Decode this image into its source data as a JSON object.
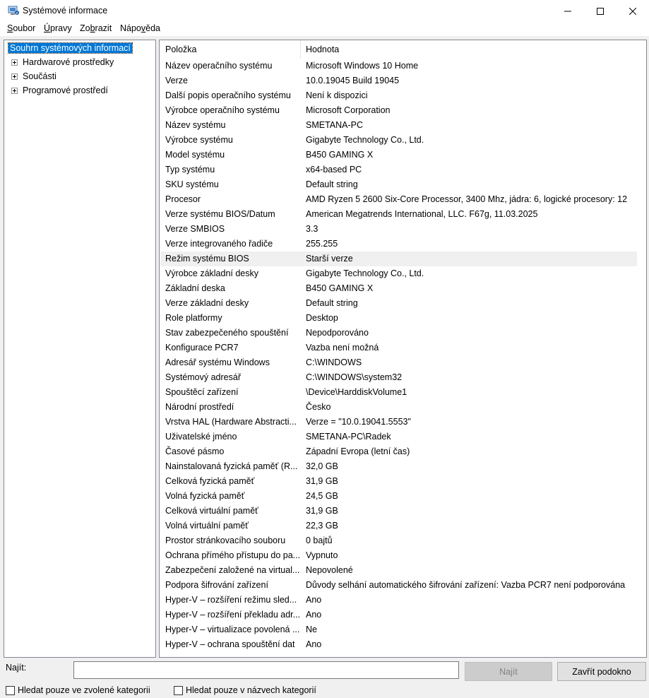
{
  "window": {
    "title": "Systémové informace"
  },
  "menu": [
    {
      "accel": "S",
      "rest": "oubor"
    },
    {
      "accel": "Ú",
      "rest": "pravy"
    },
    {
      "pre": "Zo",
      "accel": "b",
      "rest": "razit"
    },
    {
      "pre": "Nápo",
      "accel": "v",
      "rest": "ěda"
    }
  ],
  "tree": [
    "Souhrn systémových informací",
    "Hardwarové prostředky",
    "Součásti",
    "Programové prostředí"
  ],
  "list": {
    "headers": {
      "item": "Položka",
      "value": "Hodnota"
    },
    "rows": [
      [
        "Název operačního systému",
        "Microsoft Windows 10 Home"
      ],
      [
        "Verze",
        "10.0.19045 Build 19045"
      ],
      [
        "Další popis operačního systému",
        "Není k dispozici"
      ],
      [
        "Výrobce operačního systému",
        "Microsoft Corporation"
      ],
      [
        "Název systému",
        "SMETANA-PC"
      ],
      [
        "Výrobce systému",
        "Gigabyte Technology Co., Ltd."
      ],
      [
        "Model systému",
        "B450 GAMING X"
      ],
      [
        "Typ systému",
        "x64-based PC"
      ],
      [
        "SKU systému",
        "Default string"
      ],
      [
        "Procesor",
        "AMD Ryzen 5 2600 Six-Core Processor, 3400 Mhz, jádra: 6, logické procesory: 12"
      ],
      [
        "Verze systému BIOS/Datum",
        "American Megatrends International, LLC. F67g, 11.03.2025"
      ],
      [
        "Verze SMBIOS",
        "3.3"
      ],
      [
        "Verze integrovaného řadiče",
        "255.255"
      ],
      [
        "Režim systému BIOS",
        "Starší verze"
      ],
      [
        "Výrobce základní desky",
        "Gigabyte Technology Co., Ltd."
      ],
      [
        "Základní deska",
        "B450 GAMING X"
      ],
      [
        "Verze základní desky",
        "Default string"
      ],
      [
        "Role platformy",
        "Desktop"
      ],
      [
        "Stav zabezpečeného spouštění",
        "Nepodporováno"
      ],
      [
        "Konfigurace PCR7",
        "Vazba není možná"
      ],
      [
        "Adresář systému Windows",
        "C:\\WINDOWS"
      ],
      [
        "Systémový adresář",
        "C:\\WINDOWS\\system32"
      ],
      [
        "Spouštěcí zařízení",
        "\\Device\\HarddiskVolume1"
      ],
      [
        "Národní prostředí",
        "Česko"
      ],
      [
        "Vrstva HAL (Hardware Abstraction Layer)",
        "Verze = \"10.0.19041.5553\""
      ],
      [
        "Uživatelské jméno",
        "SMETANA-PC\\Radek"
      ],
      [
        "Časové pásmo",
        "Západní Evropa (letní čas)"
      ],
      [
        "Nainstalovaná fyzická paměť (RAM)",
        "32,0 GB"
      ],
      [
        "Celková fyzická paměť",
        "31,9 GB"
      ],
      [
        "Volná fyzická paměť",
        "24,5 GB"
      ],
      [
        "Celková virtuální paměť",
        "31,9 GB"
      ],
      [
        "Volná virtuální paměť",
        "22,3 GB"
      ],
      [
        "Prostor stránkovacího souboru",
        "0 bajtů"
      ],
      [
        "Ochrana přímého přístupu do paměti",
        "Vypnuto"
      ],
      [
        "Zabezpečení založené na virtualizaci",
        "Nepovolené"
      ],
      [
        "Podpora šifrování zařízení",
        "Důvody selhání automatického šifrování zařízení: Vazba PCR7 není podporována"
      ],
      [
        "Hyper-V – rozšíření režimu sledování virtuálních počítačů",
        "Ano"
      ],
      [
        "Hyper-V – rozšíření překladu adres druhé úrovně",
        "Ano"
      ],
      [
        "Hyper-V – virtualizace povolená ve firmwaru",
        "Ne"
      ],
      [
        "Hyper-V – ochrana spouštění dat",
        "Ano"
      ]
    ]
  },
  "find": {
    "label": "Najít:",
    "value": "",
    "find_button": "Najít",
    "close_button": "Zavřít podokno",
    "checkbox_selected_category": "Hledat pouze ve zvolené kategorii",
    "checkbox_category_names": "Hledat pouze v názvech kategorií"
  },
  "colors": {
    "selection": "#0078d7",
    "window_bg": "#f0f0f0"
  }
}
